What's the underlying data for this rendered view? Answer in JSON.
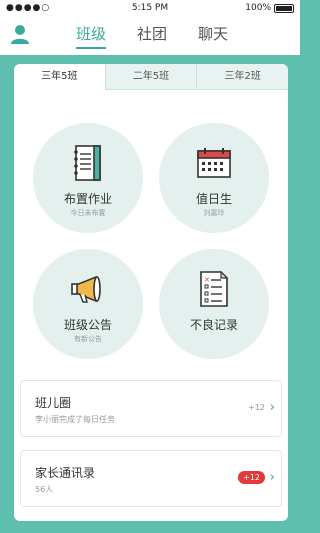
{
  "status_bar": {
    "signal": "●●●●○",
    "time": "5:15 PM",
    "battery": "100%"
  },
  "nav": {
    "tabs": [
      {
        "label": "班级"
      },
      {
        "label": "社团"
      },
      {
        "label": "聊天"
      }
    ],
    "active_index": 0
  },
  "class_tabs": [
    {
      "label": "三年5班"
    },
    {
      "label": "二年5班"
    },
    {
      "label": "三年2班"
    }
  ],
  "tiles": [
    {
      "title": "布置作业",
      "subtitle": "今日未布置",
      "icon": "notebook-icon"
    },
    {
      "title": "值日生",
      "subtitle": "刘嘉玲",
      "icon": "calendar-icon"
    },
    {
      "title": "班级公告",
      "subtitle": "有新公告",
      "icon": "megaphone-icon"
    },
    {
      "title": "不良记录",
      "subtitle": "",
      "icon": "checklist-icon"
    }
  ],
  "cards": [
    {
      "title": "班儿圈",
      "subtitle": "李小丽完成了每日任务",
      "count": "+12",
      "badge": ""
    },
    {
      "title": "家长通讯录",
      "subtitle": "56人",
      "count": "",
      "badge": "+12"
    }
  ],
  "colors": {
    "accent": "#3aa89a",
    "background": "#5fbfaf",
    "badge": "#e03a3a"
  }
}
